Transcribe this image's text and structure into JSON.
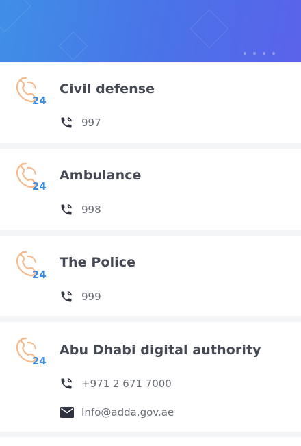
{
  "contacts": [
    {
      "name": "Civil defense",
      "phone": "997",
      "phone_icon": "phone-icon",
      "logo_icon": "emergency-24-icon"
    },
    {
      "name": "Ambulance",
      "phone": "998",
      "phone_icon": "phone-icon",
      "logo_icon": "emergency-24-icon"
    },
    {
      "name": "The Police",
      "phone": "999",
      "phone_icon": "phone-icon",
      "logo_icon": "emergency-24-icon"
    },
    {
      "name": "Abu Dhabi digital authority",
      "phone": "+971 2 671 7000",
      "email": "Info@adda.gov.ae",
      "phone_icon": "phone-icon",
      "email_icon": "mail-icon",
      "logo_icon": "emergency-24-icon"
    }
  ],
  "colors": {
    "header_start": "#3f8fe6",
    "header_end": "#5a63ea",
    "logo_orange": "#f7b98a",
    "logo_blue": "#3c8fe0",
    "title": "#454955",
    "body_text": "#6a6e78",
    "icon_dark": "#2f3340"
  }
}
